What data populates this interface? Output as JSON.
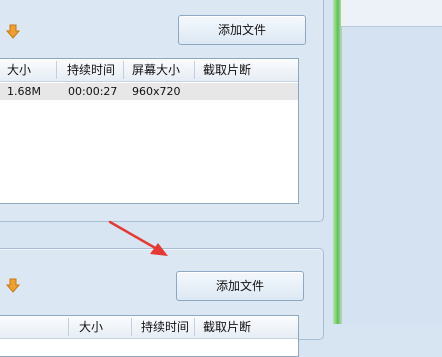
{
  "top_section": {
    "add_file_label": "添加文件",
    "table": {
      "columns": [
        "大小",
        "持续时间",
        "屏幕大小",
        "截取片断"
      ],
      "rows": [
        {
          "size": "1.68M",
          "duration": "00:00:27",
          "screen_size": "960x720",
          "clip": ""
        }
      ]
    }
  },
  "bottom_section": {
    "add_file_label": "添加文件",
    "columns": [
      "大小",
      "持续时间",
      "截取片断"
    ]
  },
  "colors": {
    "annotation_arrow": "#e53935",
    "folder_arrow": "#f0a030",
    "splitter": "#6cc75c"
  },
  "icons": [
    "down-arrow-icon",
    "annotation-arrow-icon"
  ]
}
